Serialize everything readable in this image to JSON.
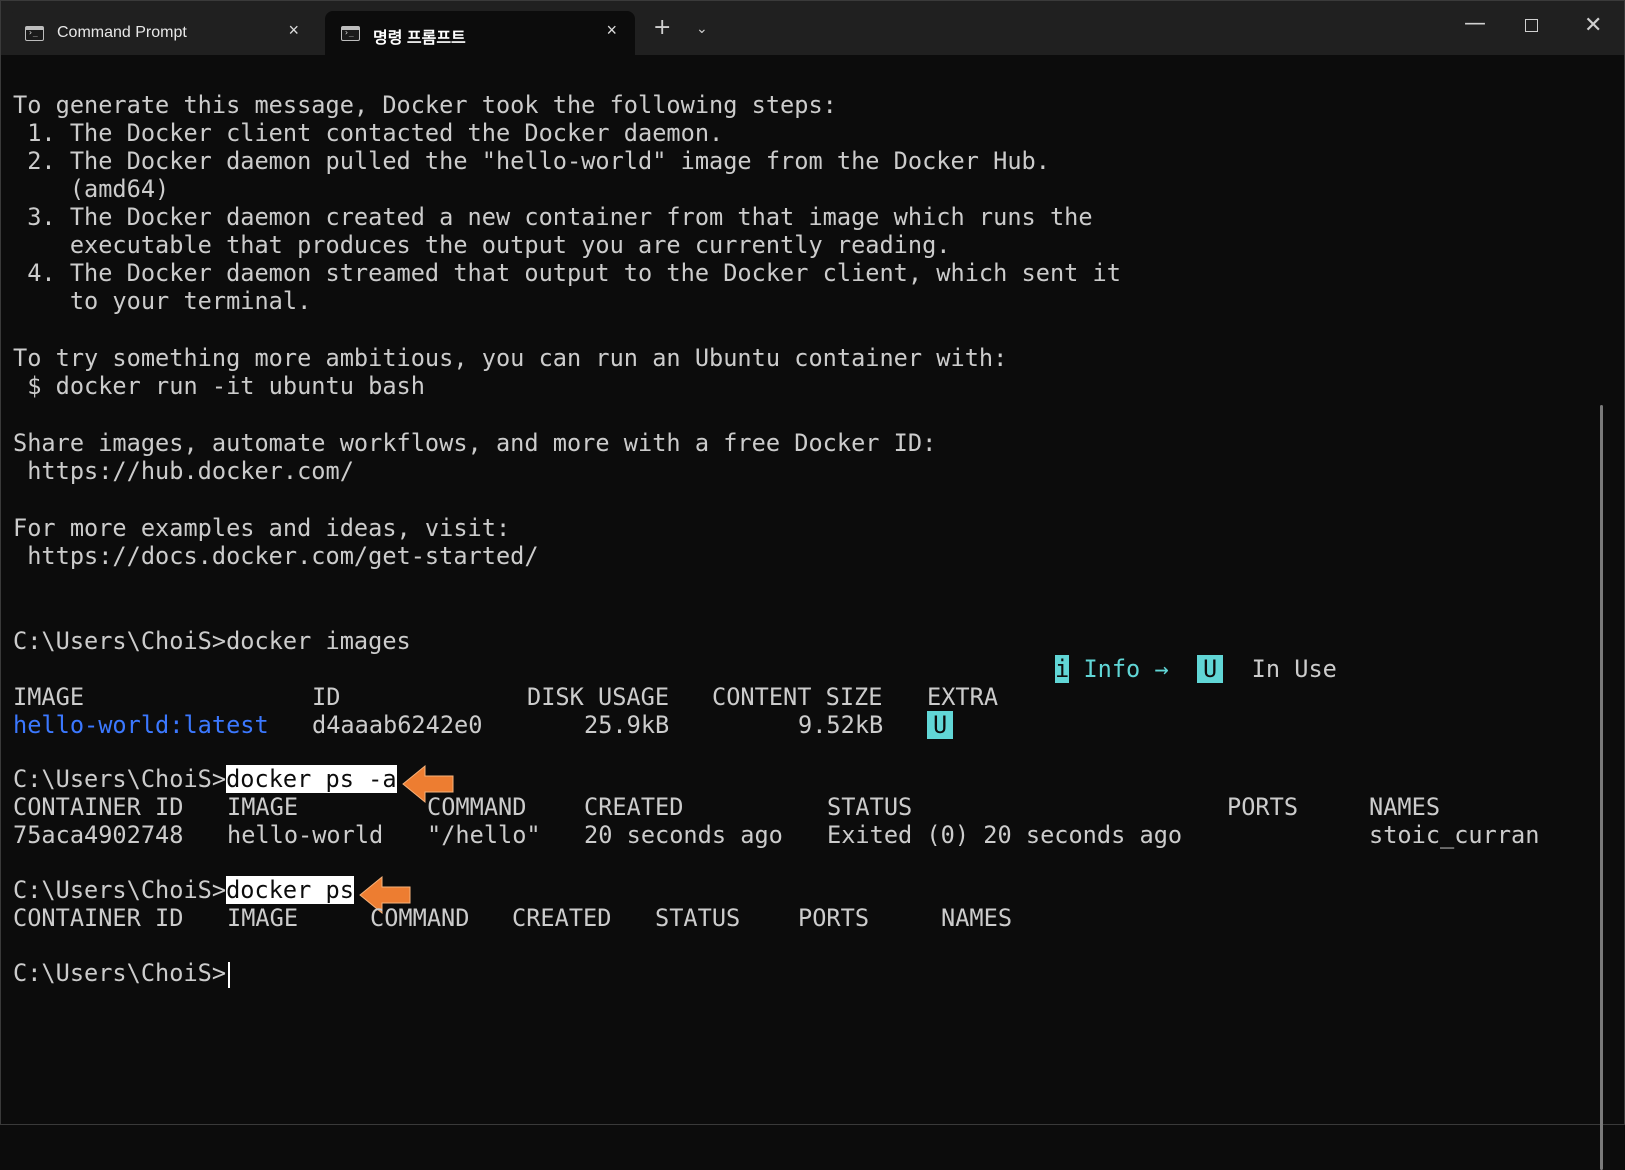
{
  "tabs": [
    {
      "label": "Command Prompt"
    },
    {
      "label": "명령 프롬프트"
    }
  ],
  "icons": {
    "tab_close": "×",
    "new_tab": "+",
    "dropdown": "⌄",
    "minimize": "—",
    "close": "✕"
  },
  "colors": {
    "background": "#0c0c0c",
    "link_blue": "#3b78ff",
    "cyan": "#61d6d6",
    "arrow": "#ed7d31"
  },
  "output": {
    "l1": "To generate this message, Docker took the following steps:",
    "l2": " 1. The Docker client contacted the Docker daemon.",
    "l3": " 2. The Docker daemon pulled the \"hello-world\" image from the Docker Hub.",
    "l4": "    (amd64)",
    "l5": " 3. The Docker daemon created a new container from that image which runs the",
    "l6": "    executable that produces the output you are currently reading.",
    "l7": " 4. The Docker daemon streamed that output to the Docker client, which sent it",
    "l8": "    to your terminal.",
    "l9": "To try something more ambitious, you can run an Ubuntu container with:",
    "l10": " $ docker run -it ubuntu bash",
    "l11": "Share images, automate workflows, and more with a free Docker ID:",
    "l12": " https://hub.docker.com/",
    "l13": "For more examples and ideas, visit:",
    "l14": " https://docs.docker.com/get-started/"
  },
  "prompt": "C:\\Users\\ChoiS>",
  "cmd_images": "docker images",
  "legend": {
    "i": "i",
    "info": "Info →",
    "u": "U",
    "in_use": "In Use"
  },
  "images_table": {
    "headers": [
      "IMAGE",
      "ID",
      "DISK USAGE",
      "CONTENT SIZE",
      "EXTRA"
    ],
    "row": {
      "image": "hello-world:latest",
      "id": "d4aaab6242e0",
      "disk": "25.9kB",
      "content": "9.52kB",
      "extra": "U"
    }
  },
  "cmd_ps_a": "docker ps -a",
  "ps_a_table": {
    "headers": [
      "CONTAINER ID",
      "IMAGE",
      "COMMAND",
      "CREATED",
      "STATUS",
      "PORTS",
      "NAMES"
    ],
    "row": {
      "id": "75aca4902748",
      "image": "hello-world",
      "command": "\"/hello\"",
      "created": "20 seconds ago",
      "status": "Exited (0) 20 seconds ago",
      "ports": "",
      "names": "stoic_curran"
    }
  },
  "cmd_ps": "docker ps",
  "ps_table": {
    "headers": [
      "CONTAINER ID",
      "IMAGE",
      "COMMAND",
      "CREATED",
      "STATUS",
      "PORTS",
      "NAMES"
    ]
  }
}
